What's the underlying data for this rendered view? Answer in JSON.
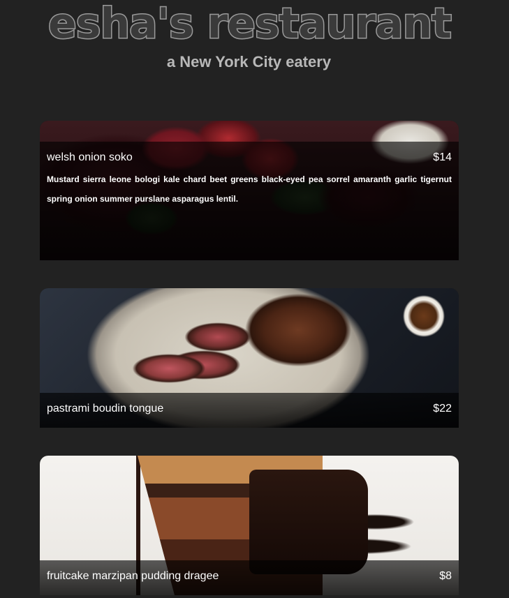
{
  "header": {
    "title": "esha's restaurant",
    "tagline": "a New York City eatery"
  },
  "menu": {
    "items": [
      {
        "name": "welsh onion soko",
        "price": "$14",
        "description": "Mustard sierra leone bologi kale chard beet greens black-eyed pea sorrel amaranth garlic tigernut spring onion summer purslane asparagus lentil.",
        "photo": "beet-salad-photo"
      },
      {
        "name": "pastrami boudin tongue",
        "price": "$22",
        "photo": "sliced-steak-photo"
      },
      {
        "name": "fruitcake marzipan pudding dragee",
        "price": "$8",
        "photo": "chocolate-cake-photo"
      }
    ]
  },
  "colors": {
    "background": "#222222",
    "title_fill": "#3a3a3a",
    "title_outline": "#9a9a9a",
    "tagline": "#b8b8b8",
    "card_text": "#ffffff"
  }
}
